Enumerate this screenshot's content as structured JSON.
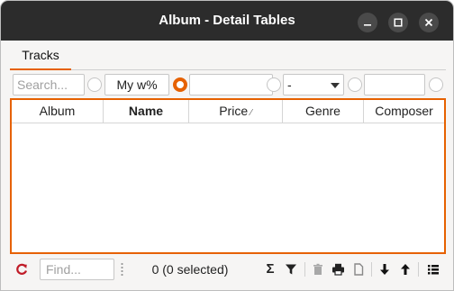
{
  "window": {
    "title": "Album - Detail Tables"
  },
  "tabs": [
    {
      "label": "Tracks",
      "active": true
    }
  ],
  "filters": {
    "search_placeholder": "Search...",
    "name_filter_value": "My w%",
    "price_filter_value": "",
    "genre_filter_value": "-",
    "composer_filter_value": ""
  },
  "table": {
    "columns": [
      {
        "label": "Album",
        "bold": false
      },
      {
        "label": "Name",
        "bold": true
      },
      {
        "label": "Price",
        "bold": false,
        "sort": "⁄"
      },
      {
        "label": "Genre",
        "bold": false
      },
      {
        "label": "Composer",
        "bold": false
      }
    ],
    "rows": []
  },
  "statusbar": {
    "find_placeholder": "Find...",
    "selection_text": "0 (0 selected)",
    "sum_icon_glyph": "Σ"
  },
  "colors": {
    "accent": "#e66100",
    "titlebar": "#2c2c2c",
    "refresh_icon": "#c01c28"
  }
}
